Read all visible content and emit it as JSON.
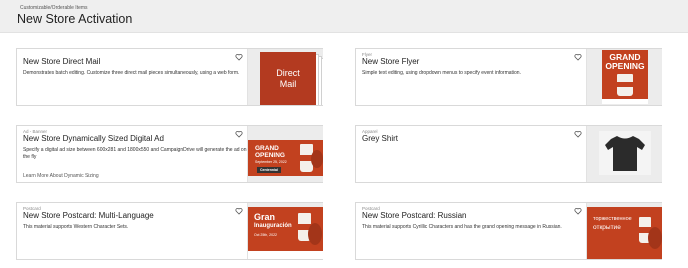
{
  "header": {
    "breadcrumb": "Customizable/Orderable Items",
    "title": "New Store Activation"
  },
  "cards": [
    {
      "category": "",
      "title": "New Store Direct Mail",
      "description": "Demonstrates batch editing. Customize three direct mail pieces simultaneously, using a web form.",
      "link": "",
      "thumb_text": [
        "Direct",
        "Mail"
      ]
    },
    {
      "category": "Flyer",
      "title": "New Store Flyer",
      "description": "Simple text editing, using dropdown menus to specify event information.",
      "link": "",
      "thumb_text": [
        "GRAND",
        "OPENING"
      ]
    },
    {
      "category": "Ad - Banner",
      "title": "New Store Dynamically Sized Digital Ad",
      "description": "Specify a digital ad size between 600x281 and 1800x550 and CampaignDrive will generate the ad on the fly",
      "link": "Learn More About Dynamic Sizing",
      "thumb_text": [
        "GRAND",
        "OPENING",
        "September 25, 2022",
        "Centennial"
      ]
    },
    {
      "category": "Apparel",
      "title": "Grey Shirt",
      "description": "",
      "link": "",
      "thumb_text": []
    },
    {
      "category": "Postcard",
      "title": "New Store Postcard: Multi-Language",
      "description": "This material supports Western Character Sets.",
      "link": "",
      "thumb_text": [
        "Gran",
        "Inauguración",
        "Oct 25th, 2022"
      ]
    },
    {
      "category": "Postcard",
      "title": "New Store Postcard: Russian",
      "description": "This material supports Cyrillic Characters and has the grand opening message in Russian.",
      "link": "",
      "thumb_text": [
        "торжественное",
        "открытие"
      ]
    }
  ],
  "colors": {
    "brand_red": "#c2411f",
    "header_bg": "#efefef"
  },
  "icons": {
    "favorite": "heart-outline-icon"
  }
}
